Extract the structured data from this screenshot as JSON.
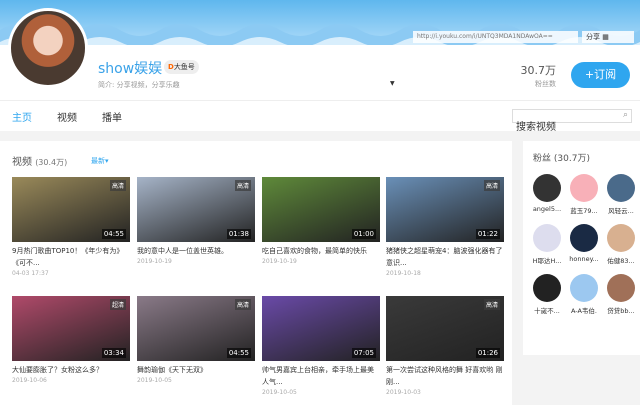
{
  "header": {
    "url": "http://i.youku.com/i/UNTQ3MDA1NDAwOA==",
    "share": "分享",
    "name": "show娱娱",
    "badge": "大鱼号",
    "intro": "简介: 分享视频，分享乐趣",
    "fans_count": "30.7万",
    "fans_label": "粉丝数",
    "subscribe": "+订阅"
  },
  "nav": {
    "tabs": [
      "主页",
      "视频",
      "播单"
    ],
    "search_placeholder": "搜索视频"
  },
  "videos": {
    "title": "视频",
    "count": "(30.4万)",
    "sort": "最新",
    "items": [
      {
        "title": "9月热门歌曲TOP10！《年少有为》《可不...",
        "date": "04-03 17:37",
        "duration": "04:55",
        "quality": "高清",
        "color": "#9a8a5a"
      },
      {
        "title": "我的意中人是一位盖世英雄。",
        "date": "2019-10-19",
        "duration": "01:38",
        "quality": "高清",
        "color": "#a6b4c8"
      },
      {
        "title": "吃自己喜欢的食物，最简单的快乐",
        "date": "2019-10-19",
        "duration": "01:00",
        "quality": "",
        "color": "#5f8a3a"
      },
      {
        "title": "猪猪侠之超星萌宠4：脑波强化器有了意识...",
        "date": "2019-10-18",
        "duration": "01:22",
        "quality": "高清",
        "color": "#6a90b8"
      },
      {
        "title": "大仙要膨胀了？女粉这么多？",
        "date": "2019-10-06",
        "duration": "03:34",
        "quality": "超清",
        "color": "#b04a6a"
      },
      {
        "title": "舞韵瑜伽《天下无双》",
        "date": "2019-10-05",
        "duration": "04:55",
        "quality": "高清",
        "color": "#8a7a88"
      },
      {
        "title": "帅气男嘉宾上台相亲，牵手场上最美人气...",
        "date": "2019-10-05",
        "duration": "07:05",
        "quality": "",
        "color": "#6a4aa8"
      },
      {
        "title": "第一次尝试这种风格的舞 好喜欢哟 刚刚...",
        "date": "2019-10-03",
        "duration": "01:26",
        "quality": "高清",
        "color": "#3a3a3a"
      }
    ]
  },
  "fans": {
    "title": "粉丝",
    "count": "(30.7万)",
    "items": [
      {
        "name": "angel5...",
        "color": "#333"
      },
      {
        "name": "蓝玉79...",
        "color": "#f8b0b8"
      },
      {
        "name": "风轻云...",
        "color": "#4a6a8a"
      },
      {
        "name": "H耶达H...",
        "color": "#dde"
      },
      {
        "name": "honney...",
        "color": "#1a2a44"
      },
      {
        "name": "佑健83...",
        "color": "#d8b090"
      },
      {
        "name": "十嵗不...",
        "color": "#222"
      },
      {
        "name": "A-A韦伯.",
        "color": "#9cc8f0"
      },
      {
        "name": "贷贷bb...",
        "color": "#a07058"
      }
    ]
  }
}
